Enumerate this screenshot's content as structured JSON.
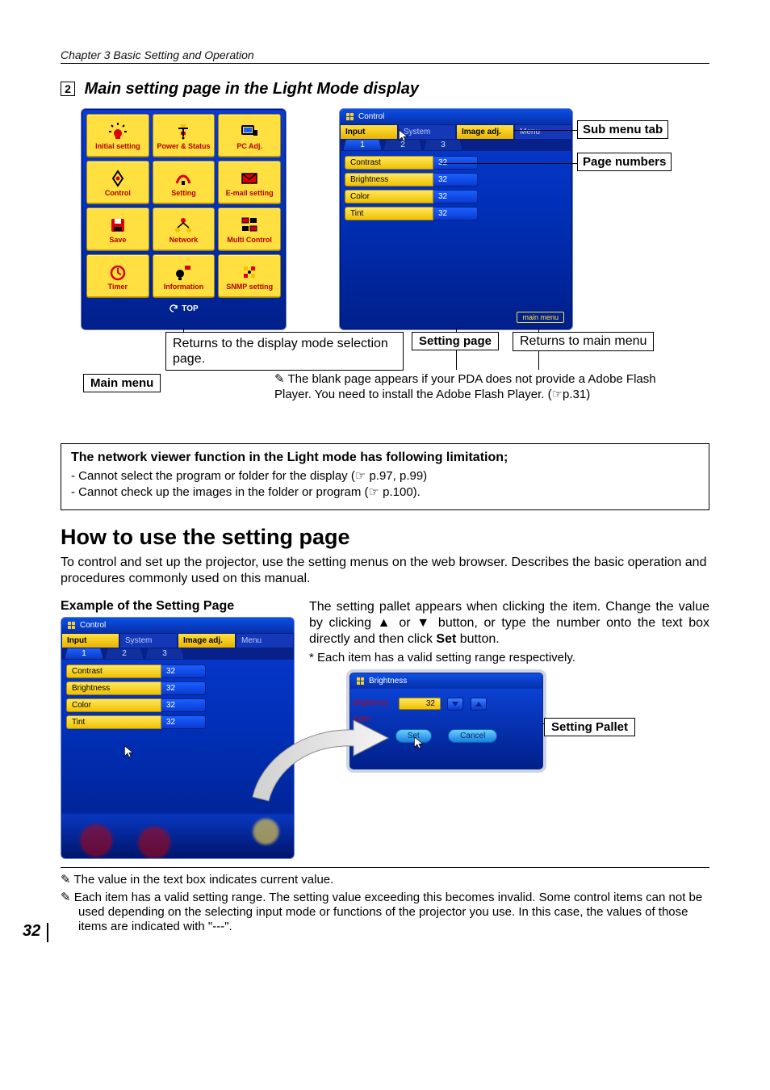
{
  "chapter": "Chapter 3 Basic Setting and Operation",
  "section": {
    "num": "2",
    "title": "Main setting page in the Light Mode display"
  },
  "mainMenu": {
    "items": [
      {
        "label": "Initial setting",
        "icon": "initial-setting-icon"
      },
      {
        "label": "Power & Status",
        "icon": "power-status-icon"
      },
      {
        "label": "PC Adj.",
        "icon": "pc-adj-icon"
      },
      {
        "label": "Control",
        "icon": "control-icon"
      },
      {
        "label": "Setting",
        "icon": "setting-icon"
      },
      {
        "label": "E-mail setting",
        "icon": "email-setting-icon"
      },
      {
        "label": "Save",
        "icon": "save-icon"
      },
      {
        "label": "Network",
        "icon": "network-icon"
      },
      {
        "label": "Multi Control",
        "icon": "multi-control-icon"
      },
      {
        "label": "Timer",
        "icon": "timer-icon"
      },
      {
        "label": "Information",
        "icon": "information-icon"
      },
      {
        "label": "SNMP setting",
        "icon": "snmp-setting-icon"
      }
    ],
    "topLabel": "TOP"
  },
  "settingPage": {
    "title": "Control",
    "tabs": [
      {
        "label": "Input",
        "active": true
      },
      {
        "label": "System",
        "active": false
      },
      {
        "label": "Image adj.",
        "active": true
      },
      {
        "label": "Menu",
        "active": false
      }
    ],
    "pageTabs": [
      "1",
      "2",
      "3"
    ],
    "activePageTab": 0,
    "fields": [
      {
        "label": "Contrast",
        "value": "32"
      },
      {
        "label": "Brightness",
        "value": "32"
      },
      {
        "label": "Color",
        "value": "32"
      },
      {
        "label": "Tint",
        "value": "32"
      }
    ],
    "mainMenuBtn": "main menu"
  },
  "callouts": {
    "subMenuTab": "Sub menu tab",
    "pageNumbers": "Page numbers",
    "returnsTop": "Returns to the display mode selection page.",
    "settingPage": "Setting page",
    "returnsMain": "Returns to main menu",
    "mainMenu": "Main menu",
    "blankNote1": "✎ The blank page appears if your PDA does not provide a Adobe Flash Player. You need to install the Adobe Flash Player. (☞p.31)"
  },
  "limitation": {
    "title": "The network viewer function in the Light mode has following limitation;",
    "items": [
      "- Cannot select the program or folder for the display (☞ p.97, p.99)",
      "- Cannot check up the images in the folder or program (☞ p.100)."
    ]
  },
  "howto": {
    "heading": "How to use the setting page",
    "body": "To control and set up the projector, use the setting menus on the web browser. Describes the basic operation and procedures commonly used on this manual."
  },
  "example": {
    "title": "Example of the Setting Page",
    "panel": {
      "title": "Control",
      "tabs": [
        {
          "label": "Input",
          "active": true
        },
        {
          "label": "System",
          "active": false
        },
        {
          "label": "Image adj.",
          "active": true
        },
        {
          "label": "Menu",
          "active": false
        }
      ],
      "pageTabs": [
        "1",
        "2",
        "3"
      ],
      "activePageTab": 0,
      "fields": [
        {
          "label": "Contrast",
          "value": "32"
        },
        {
          "label": "Brightness",
          "value": "32"
        },
        {
          "label": "Color",
          "value": "32"
        },
        {
          "label": "Tint",
          "value": "32"
        }
      ]
    },
    "desc1": "The setting pallet appears when clicking the item. Change the value by clicking ▲ or ▼ button, or type the number onto the text box directly and then click ",
    "descSet": "Set",
    "desc2": " button.",
    "note": "* Each item has a valid setting range respectively.",
    "pallet": {
      "title": "Brightness",
      "sub1": "Brightness",
      "sub2": "Color",
      "value": "32",
      "setBtn": "Set",
      "cancelBtn": "Cancel",
      "callout": "Setting Pallet"
    }
  },
  "footnotes": [
    "✎ The value in the text box indicates current value.",
    "✎ Each item has a valid setting range. The setting value exceeding this becomes invalid. Some control items can not be used depending on the selecting input mode or functions of the projector you use. In this case, the values of those items are indicated with \"---\"."
  ],
  "pageNumber": "32"
}
